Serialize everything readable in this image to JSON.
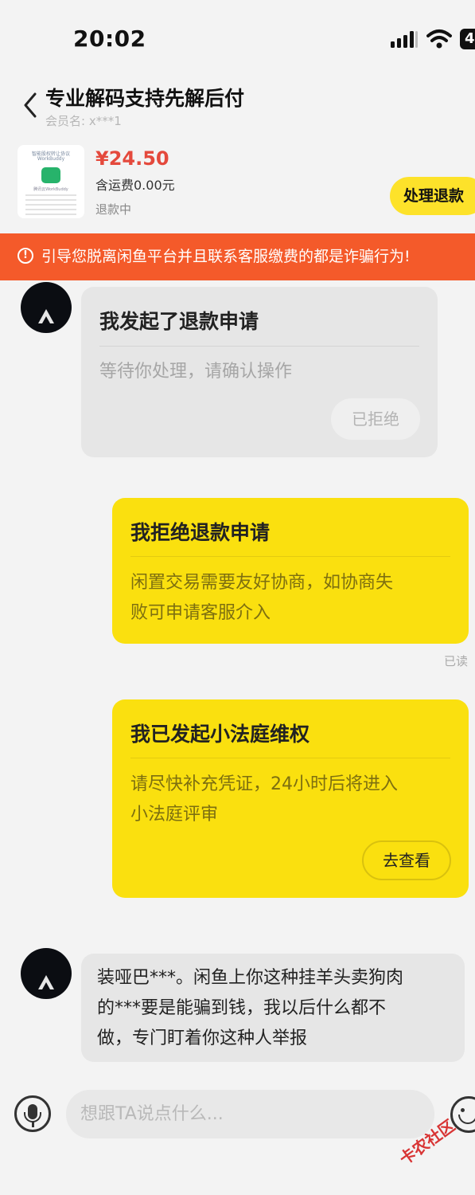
{
  "status_bar": {
    "time": "20:02",
    "battery_label": "4"
  },
  "header": {
    "title": "专业解码支持先解后付",
    "member_label": "会员名: x***1"
  },
  "product": {
    "thumb_line1": "智能股权转让协议",
    "thumb_line2": "WorkBuddy",
    "thumb_caption": "腾讯云WorkBuddy",
    "price": "¥24.50",
    "shipping": "含运费0.00元",
    "status": "退款中",
    "action_label": "处理退款"
  },
  "warning": {
    "icon": "!",
    "text": "引导您脱离闲鱼平台并且联系客服缴费的都是诈骗行为!"
  },
  "messages": {
    "refund_request": {
      "title": "我发起了退款申请",
      "body": "等待你处理，请确认操作",
      "button": "已拒绝"
    },
    "refund_rejected": {
      "title": "我拒绝退款申请",
      "body_line1": "闲置交易需要友好协商，如协商失",
      "body_line2": "败可申请客服介入",
      "read_status": "已读"
    },
    "court": {
      "title": "我已发起小法庭维权",
      "body_line1": "请尽快补充凭证，24小时后将进入",
      "body_line2": "小法庭评审",
      "button": "去查看"
    },
    "text_message": {
      "line1": "装哑巴***。闲鱼上你这种挂羊头卖狗肉",
      "line2": "的***要是能骗到钱，我以后什么都不",
      "line3": "做，专门盯着你这种人举报"
    }
  },
  "input_bar": {
    "placeholder": "想跟TA说点什么..."
  },
  "watermark": "卡农社区",
  "colors": {
    "accent_yellow": "#fae00f",
    "warning_orange": "#f45a2a",
    "price_red": "#e4493c"
  }
}
